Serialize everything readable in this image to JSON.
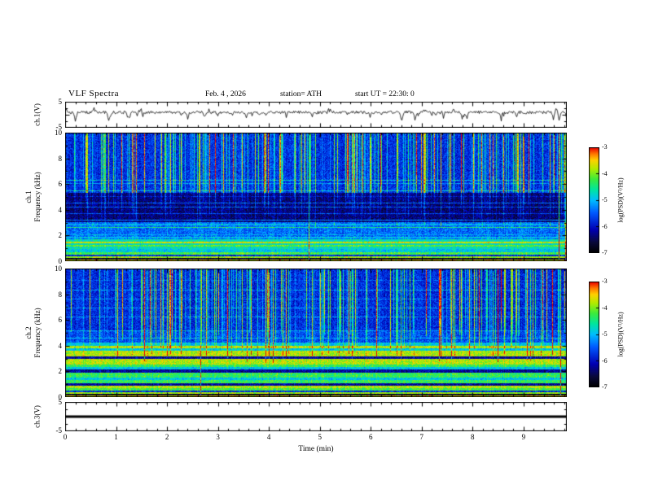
{
  "header": {
    "title": "VLF Spectra",
    "date": "Feb. 4  , 2026",
    "station": "station= ATH",
    "start_ut": "start UT =  22:30: 0"
  },
  "xaxis": {
    "label": "Time (min)",
    "range": [
      0,
      9.85
    ],
    "ticks": [
      "0",
      "1",
      "2",
      "3",
      "4",
      "5",
      "6",
      "7",
      "8",
      "9"
    ]
  },
  "chart_data": [
    {
      "type": "line",
      "name": "ch1_voltage_waveform",
      "ylabel": "ch.1(V)",
      "ylim": [
        -5,
        5
      ],
      "ytick_labels": [
        "5",
        "-5"
      ],
      "line_color": "#000000",
      "description": "Channel-1 broadband voltage: noisy trace fluctuating near +1 V with intermittent negative spikes reaching about -4 V across 0-9.85 min"
    },
    {
      "type": "heatmap",
      "name": "ch1_spectrogram",
      "ylabel_channel": "ch.1",
      "ylabel_unit": "Frequency (kHz)",
      "ylim": [
        0,
        10
      ],
      "ytick_labels": [
        "10",
        "8",
        "6",
        "4",
        "2",
        "0"
      ],
      "value_range": [
        -7,
        -3
      ],
      "colorbar": {
        "label": "log(PSD)(V²/Hz)",
        "tick_labels": [
          "-3",
          "-4",
          "-5",
          "-6",
          "-7"
        ]
      },
      "features": [
        "dense vertical sferic streaks strongest above 5 kHz",
        "dark low-PSD attenuation band near 3-5.3 kHz",
        "narrow horizontal PSD lines between 1 and 6.5 kHz",
        "bright quasi-continuous emission bands below 1 kHz",
        "a few full-height yellow interference lines"
      ],
      "colormap_stops": [
        [
          0.0,
          "#000000"
        ],
        [
          0.1,
          "#0a0a3c"
        ],
        [
          0.22,
          "#0000b4"
        ],
        [
          0.38,
          "#005aff"
        ],
        [
          0.5,
          "#00beff"
        ],
        [
          0.6,
          "#00e6a0"
        ],
        [
          0.7,
          "#3ceb3c"
        ],
        [
          0.8,
          "#b4eb00"
        ],
        [
          0.88,
          "#ffd200"
        ],
        [
          0.94,
          "#ff7800"
        ],
        [
          1.0,
          "#eb0000"
        ]
      ]
    },
    {
      "type": "heatmap",
      "name": "ch2_spectrogram",
      "ylabel_channel": "ch.2",
      "ylabel_unit": "Frequency (kHz)",
      "ylim": [
        0,
        10
      ],
      "ytick_labels": [
        "10",
        "8",
        "6",
        "4",
        "2",
        "0"
      ],
      "value_range": [
        -7,
        -3
      ],
      "colorbar": {
        "label": "log(PSD)(V²/Hz)",
        "tick_labels": [
          "-3",
          "-4",
          "-5",
          "-6",
          "-7"
        ]
      },
      "features": [
        "vertical sferic streaks above 5 kHz",
        "strong layered horizontal emission bands from 0 to about 4.2 kHz (green/yellow over cyan/blue)",
        "bright bands below 1 kHz"
      ]
    },
    {
      "type": "line",
      "name": "ch3_voltage_waveform",
      "ylabel": "ch.3(V)",
      "ylim": [
        -5,
        5
      ],
      "ytick_labels": [
        "5",
        "-5"
      ],
      "line_color": "#000000",
      "description": "Flat thick black line at 0 V for the whole interval (channel inactive)"
    }
  ]
}
